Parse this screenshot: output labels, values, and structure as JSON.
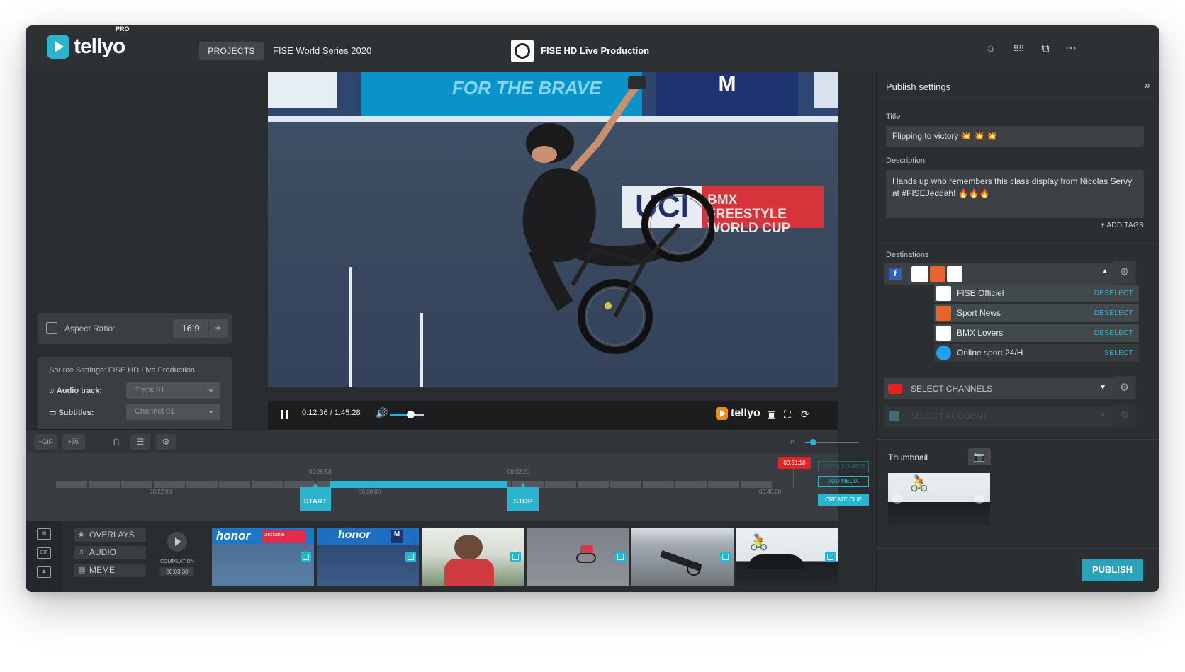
{
  "header": {
    "logo_text": "tellyo",
    "logo_badge": "PRO",
    "projects_label": "PROJECTS",
    "project_name": "FISE World Series 2020",
    "production_name": "FISE HD Live Production"
  },
  "left_panel": {
    "aspect_label": "Aspect Ratio:",
    "aspect_value": "16:9",
    "aspect_add": "+",
    "source_title": "Source Settings: FISE HD Live Production",
    "audio_label": "Audio track:",
    "audio_value": "Track 01",
    "subtitles_label": "Subtitles:",
    "subtitles_value": "Channel 01"
  },
  "video": {
    "banner_text": "FOR THE BRAVE",
    "banner_navy_text": "M",
    "uci_text": "UCI",
    "uci_sub": "BMX FREESTYLE WORLD CUP",
    "time_display": "0:12:36 / 1.45:28",
    "progress": 0.44,
    "volume": 0.6,
    "player_logo": "tellyo"
  },
  "toolbar": {
    "gif_label": "+GIF",
    "image_label": "+",
    "zoom": 0.1
  },
  "timeline": {
    "labels_top": [
      "00:26:53",
      "00:32:20"
    ],
    "labels_bottom": [
      "00:22:00",
      "00:28:00",
      "00:40:00"
    ],
    "playhead_time": "00:31:18",
    "start_label": "START",
    "stop_label": "STOP",
    "go_to_source": "GO TO SOURCE",
    "add_media": "ADD MEDIA",
    "create_clip": "CREATE CLIP"
  },
  "strip": {
    "overlays": "OVERLAYS",
    "audio": "AUDIO",
    "meme": "MEME",
    "compilation_label": "COMPILATION",
    "compilation_time": "00:03:30",
    "thumbs": [
      {
        "text": "honor",
        "sub": "Occitanie"
      },
      {
        "text": "honor",
        "sub": "M"
      },
      {
        "text": "",
        "sub": ""
      },
      {
        "text": "",
        "sub": ""
      },
      {
        "text": "",
        "sub": ""
      },
      {
        "text": "",
        "sub": ""
      }
    ]
  },
  "publish_settings": {
    "title": "Publish settings",
    "title_label": "Title",
    "title_value": "Flipping to victory  💥 💥 💥",
    "description_label": "Description",
    "description_value": "Hands up who remembers this class display from Nicolas Servy at #FISEJeddah! 🔥🔥🔥",
    "add_tags": "+ ADD TAGS",
    "destinations_label": "Destinations",
    "destinations": [
      {
        "name": "FISE Officiel",
        "action": "DESELECT",
        "color": "#ffffff"
      },
      {
        "name": "Sport News",
        "action": "DESELECT",
        "color": "#e8642a"
      },
      {
        "name": "BMX Lovers",
        "action": "DESELECT",
        "color": "#ffffff"
      },
      {
        "name": "Online sport 24/H",
        "action": "SELECT",
        "color": "#1da1f2"
      }
    ],
    "youtube_select": "SELECT CHANNELS",
    "account_select": "SELECT ACCOUNT",
    "thumbnail_label": "Thumbnail",
    "publish_label": "PUBLISH"
  },
  "colors": {
    "accent": "#2bb4cf",
    "panel": "#2c2f32",
    "red": "#e02323"
  }
}
